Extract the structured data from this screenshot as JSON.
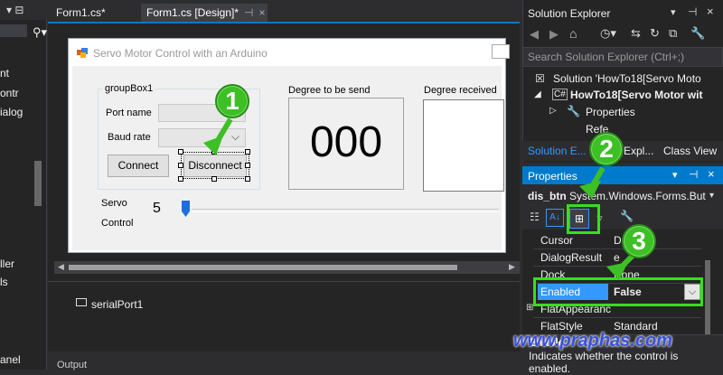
{
  "left_panel": {
    "partial_labels": [
      "nt",
      "ontr",
      "ialog",
      "ller",
      "ls",
      "anel"
    ]
  },
  "editor_tabs": [
    {
      "label": "Form1.cs*"
    },
    {
      "label": "Form1.cs [Design]*",
      "close": "×"
    }
  ],
  "form": {
    "title": "Servo Motor Control with an Arduino",
    "groupbox_title": "groupBox1",
    "port_name_label": "Port name",
    "baud_rate_label": "Baud rate",
    "connect_label": "Connect",
    "disconnect_label": "Disconnect",
    "degree_send_label": "Degree to be send",
    "degree_received_label": "Degree received",
    "degree_value": "000",
    "servo_label": "Servo",
    "control_label": "Control",
    "slider_value": "5"
  },
  "component_tray": {
    "serial_port": "serialPort1",
    "output_tab": "Output"
  },
  "solution_explorer": {
    "title": "Solution Explorer",
    "search_placeholder": "Search Solution Explorer (Ctrl+;)",
    "solution_node": "Solution 'HowTo18[Servo Moto",
    "project_node": "HowTo18[Servo Motor wit",
    "properties_node": "Properties",
    "refs_node": "Refe",
    "bottom_tabs": [
      "Solution E...",
      "Expl...",
      "Class View"
    ]
  },
  "properties": {
    "title": "Properties",
    "object_name": "dis_btn",
    "object_type": "System.Windows.Forms.But",
    "rows": [
      {
        "name": "Cursor",
        "value": "D"
      },
      {
        "name": "DialogResult",
        "value": "e"
      },
      {
        "name": "Dock",
        "value": "None"
      },
      {
        "name": "Enabled",
        "value": "False"
      },
      {
        "name": "FlatAppearanc",
        "value": ""
      },
      {
        "name": "FlatStyle",
        "value": "Standard"
      }
    ],
    "description_title": "Enable",
    "description_text": "Indicates whether the control is enabled."
  },
  "annotations": [
    "1",
    "2",
    "3"
  ],
  "watermark": "www.praphas.com",
  "colors": {
    "accent": "#007acc",
    "marker_green": "#3dbf26",
    "highlight_green": "#35e01c",
    "selected_row": "#3399ff"
  }
}
